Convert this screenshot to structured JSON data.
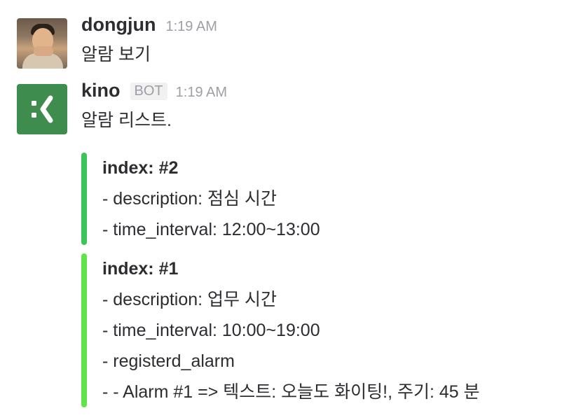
{
  "messages": [
    {
      "sender": "dongjun",
      "timestamp": "1:19 AM",
      "text": "알람 보기",
      "avatar": "user-photo"
    },
    {
      "sender": "kino",
      "badge": "BOT",
      "timestamp": "1:19 AM",
      "text": "알람 리스트.",
      "avatar": "kino-logo-icon",
      "attachments": [
        {
          "color": "#3cc35a",
          "title": "index: #2",
          "lines": [
            "- description: 점심 시간",
            "- time_interval: 12:00~13:00"
          ]
        },
        {
          "color": "#5fe24a",
          "title": "index: #1",
          "lines": [
            "- description: 업무 시간",
            "- time_interval: 10:00~19:00",
            "- registerd_alarm",
            "- - Alarm #1 => 텍스트: 오늘도 화이팅!, 주기: 45 분"
          ]
        }
      ]
    }
  ],
  "colors": {
    "bot_avatar_bg": "#3e8d4e",
    "timestamp": "#9e9ea6"
  }
}
